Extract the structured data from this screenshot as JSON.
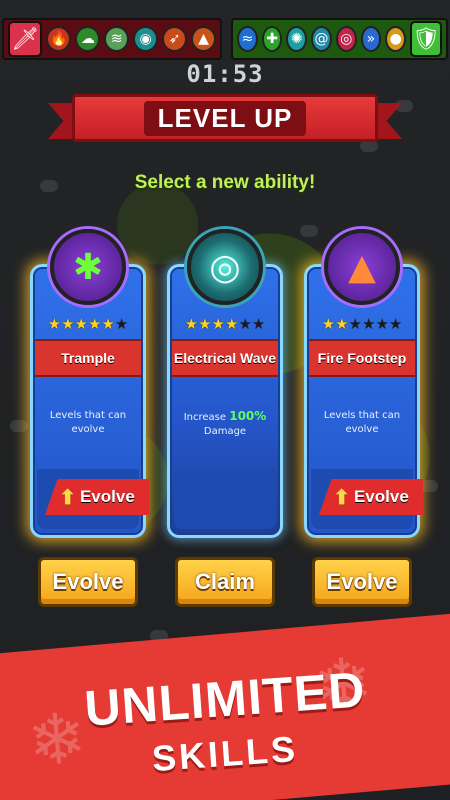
{
  "hud": {
    "timer": "01:53",
    "attack_slots": [
      "sword-icon",
      "fire-icon",
      "poison-cloud-icon",
      "wind-icon",
      "energy-orb-icon",
      "rocket-icon",
      "boot-icon"
    ],
    "defense_slots": [
      "water-icon",
      "heal-cross-icon",
      "burst-icon",
      "tornado-icon",
      "target-icon",
      "speed-icon",
      "coin-icon",
      "shield-icon"
    ]
  },
  "banner": {
    "title": "LEVEL UP"
  },
  "subtitle": "Select a new ability!",
  "cards": [
    {
      "name": "Trample",
      "icon": "trample-icon",
      "stars_filled": 5,
      "stars_total": 6,
      "description": "Levels that can evolve",
      "tag": "Evolve",
      "button": "Evolve",
      "colors": {
        "icon_bg": "#6a2fa8",
        "glow": "#ffb82a"
      }
    },
    {
      "name": "Electrical Wave",
      "icon": "electrical-wave-icon",
      "stars_filled": 4,
      "stars_total": 6,
      "description_prefix": "Increase",
      "description_value": "100%",
      "description_suffix": "Damage",
      "button": "Claim",
      "colors": {
        "icon_bg": "#1d6e73"
      }
    },
    {
      "name": "Fire Footstep",
      "icon": "fire-footstep-icon",
      "stars_filled": 2,
      "stars_total": 6,
      "description": "Levels that can evolve",
      "tag": "Evolve",
      "button": "Evolve",
      "colors": {
        "icon_bg": "#6a2fa8",
        "glow": "#ffb82a"
      }
    }
  ],
  "promo": {
    "line1": "UNLIMITED",
    "line2": "SKILLS"
  },
  "colors": {
    "card_blue": "#2f71ea",
    "name_band_red": "#d9352e",
    "button_yellow": "#f6a419",
    "subtitle_green": "#bff05a",
    "promo_red": "#e63a34"
  }
}
